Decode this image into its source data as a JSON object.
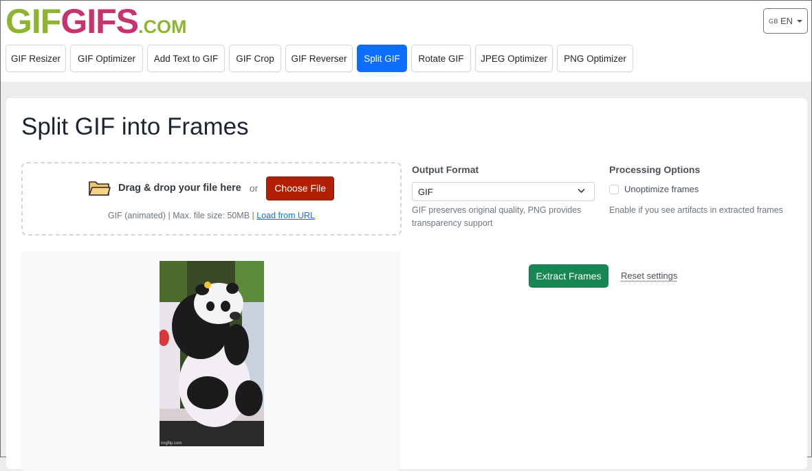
{
  "logo": {
    "part1": "GIF",
    "part2": "GIFS",
    "domain": ".COM"
  },
  "language": {
    "flag": "GB",
    "label": "EN"
  },
  "nav": {
    "tabs": [
      {
        "label": "GIF Resizer"
      },
      {
        "label": "GIF Optimizer"
      },
      {
        "label": "Add Text to GIF"
      },
      {
        "label": "GIF Crop"
      },
      {
        "label": "GIF Reverser"
      },
      {
        "label": "Split GIF"
      },
      {
        "label": "Rotate GIF"
      },
      {
        "label": "JPEG Optimizer"
      },
      {
        "label": "PNG Optimizer"
      }
    ],
    "active": "Split GIF"
  },
  "page": {
    "title": "Split GIF into Frames"
  },
  "upload": {
    "drag_text": "Drag & drop your file here",
    "or_text": "or",
    "choose_label": "Choose File",
    "info_text": "GIF (animated) | Max. file size: 50MB |",
    "url_link": "Load from URL"
  },
  "output": {
    "label": "Output Format",
    "selected": "GIF",
    "help": "GIF preserves original quality, PNG provides transparency support"
  },
  "processing": {
    "label": "Processing Options",
    "checkbox_label": "Unoptimize frames",
    "checked": false,
    "help": "Enable if you see artifacts in extracted frames"
  },
  "preview": {
    "watermark": "imgflip.com"
  },
  "actions": {
    "extract_label": "Extract Frames",
    "reset_label": "Reset settings"
  },
  "colors": {
    "brand_green": "#8db532",
    "brand_pink": "#c7336f",
    "primary": "#0d6efd",
    "choose": "#b21f03",
    "extract": "#198754"
  }
}
